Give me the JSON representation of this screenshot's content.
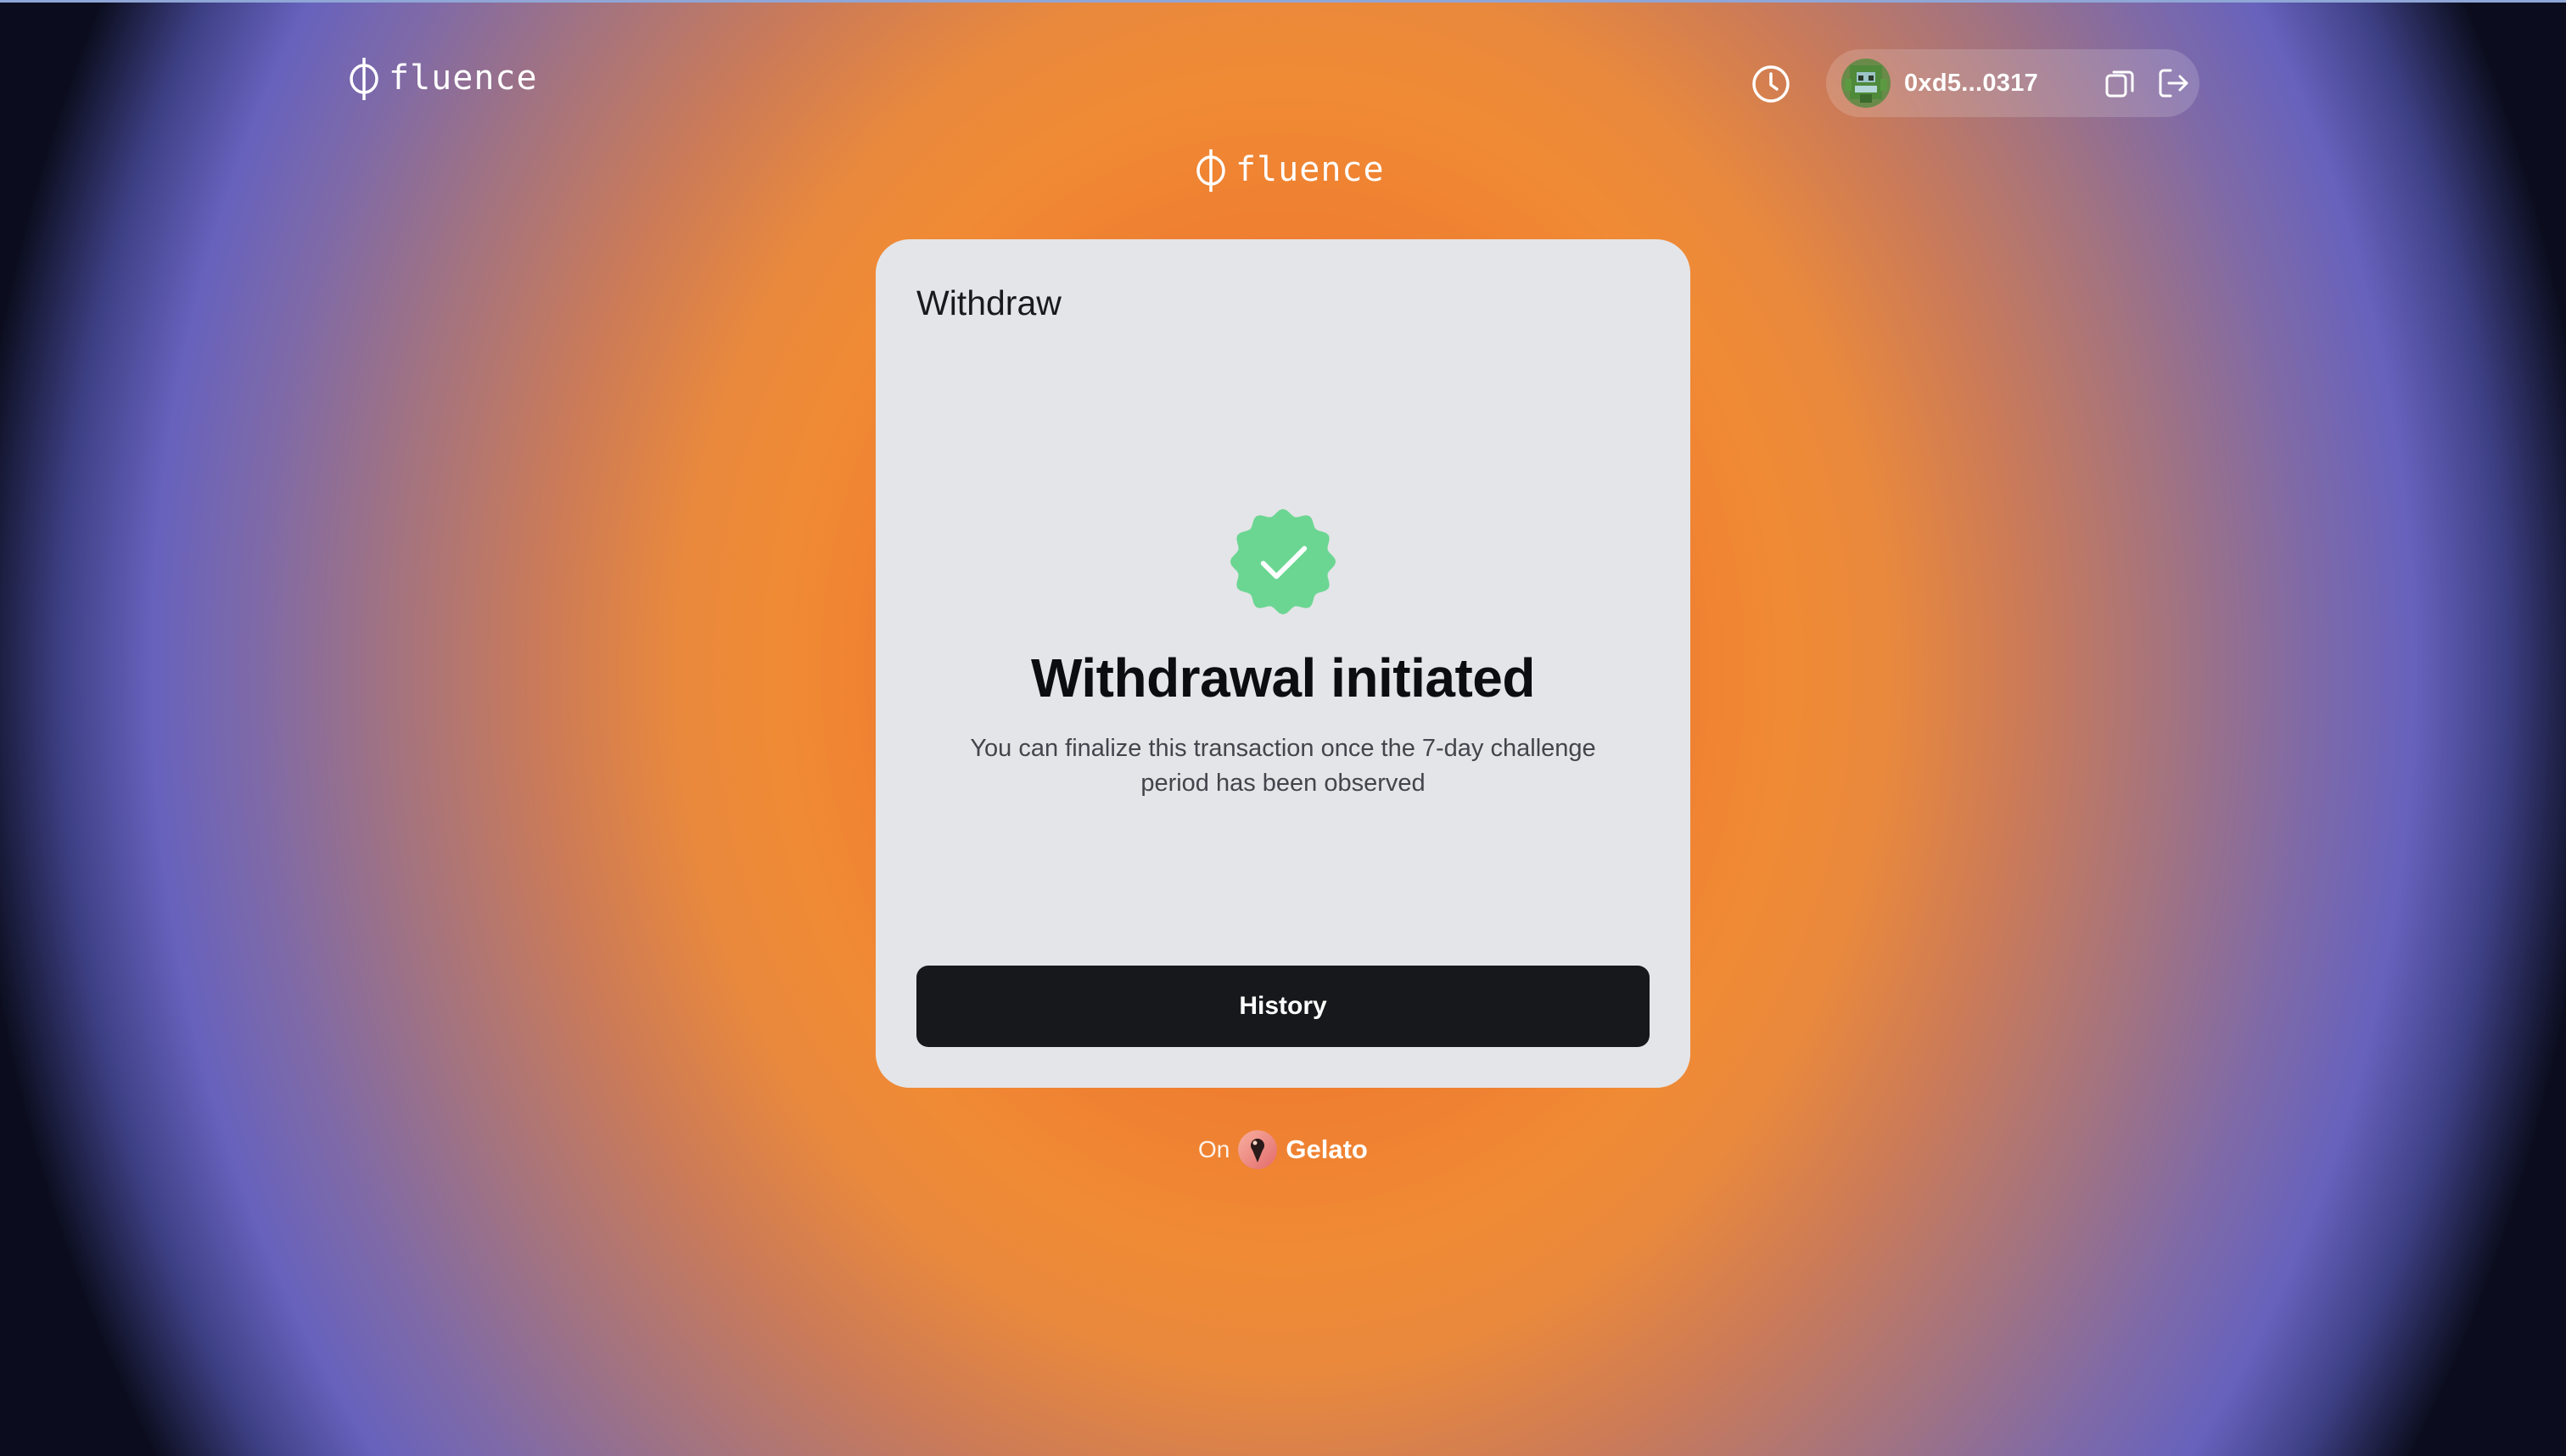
{
  "header": {
    "logo_text": "fluence",
    "account": {
      "address": "0xd5...0317"
    },
    "icons": {
      "history": "clock-icon",
      "copy": "copy-icon",
      "logout": "logout-icon"
    }
  },
  "brand": {
    "logo_text": "fluence"
  },
  "card": {
    "title": "Withdraw",
    "headline": "Withdrawal initiated",
    "description": "You can finalize this transaction once the 7-day challenge period has been observed",
    "history_button": "History",
    "status_icon": "check-badge-icon"
  },
  "footer": {
    "on_label": "On",
    "provider": "Gelato"
  },
  "colors": {
    "card_background": "#e4e5e8",
    "primary_button": "#17181b",
    "success_badge": "#6bd692",
    "accent_orange": "#f08a34",
    "accent_violet": "#6762bd"
  }
}
